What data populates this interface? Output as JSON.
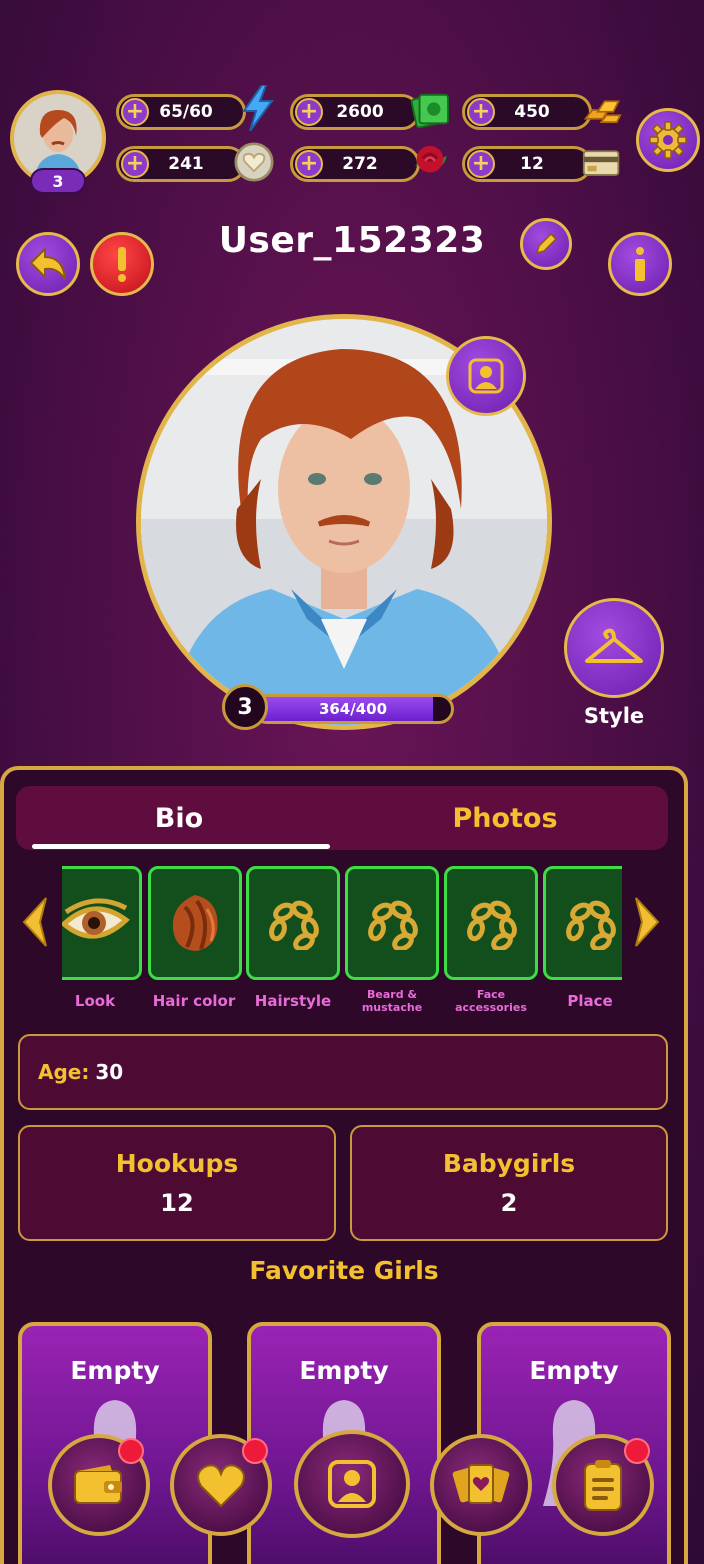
{
  "player": {
    "level": "3",
    "username": "User_152323",
    "xp": "364/400",
    "xp_fraction": 0.91
  },
  "resources": {
    "energy": "65/60",
    "cash": "2600",
    "gold": "450",
    "hearts": "241",
    "roses": "272",
    "cards": "12"
  },
  "actions": {
    "style_label": "Style"
  },
  "tabs": [
    {
      "label": "Bio"
    },
    {
      "label": "Photos"
    }
  ],
  "categories": [
    {
      "label": "Look",
      "icon": "eye-icon"
    },
    {
      "label": "Hair color",
      "icon": "hair-icon"
    },
    {
      "label": "Hairstyle",
      "icon": "chain-icon"
    },
    {
      "label": "Beard & mustache",
      "icon": "chain-icon"
    },
    {
      "label": "Face accessories",
      "icon": "chain-icon"
    },
    {
      "label": "Place",
      "icon": "chain-icon"
    }
  ],
  "bio": {
    "age_label": "Age:",
    "age_value": "30",
    "hookups_label": "Hookups",
    "hookups_value": "12",
    "babygirls_label": "Babygirls",
    "babygirls_value": "2",
    "favorites_title": "Favorite Girls",
    "favorites": [
      {
        "label": "Empty"
      },
      {
        "label": "Empty"
      },
      {
        "label": "Empty"
      }
    ]
  },
  "colors": {
    "gold": "#e2b54a",
    "purple": "#8d39c9",
    "magenta_bg": "#4a0e45",
    "green_card": "#3ddd45"
  }
}
